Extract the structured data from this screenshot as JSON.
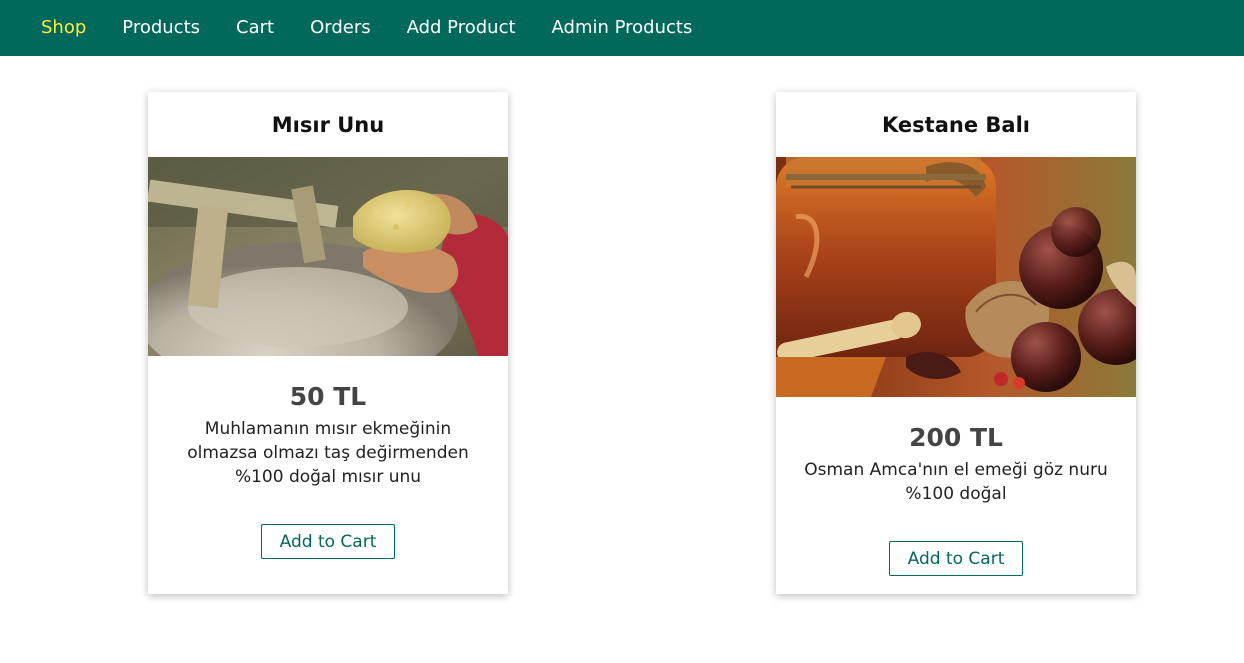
{
  "nav": {
    "items": [
      {
        "label": "Shop",
        "active": true
      },
      {
        "label": "Products"
      },
      {
        "label": "Cart"
      },
      {
        "label": "Orders"
      },
      {
        "label": "Add Product"
      },
      {
        "label": "Admin Products"
      }
    ],
    "active_color": "#ffeb3b",
    "background_color": "#00695c"
  },
  "products": [
    {
      "title": "Mısır Unu",
      "price": "50 TL",
      "description": "Muhlamanın mısır ekmeğinin olmazsa olmazı taş değirmenden %100 doğal mısır unu",
      "button_label": "Add to Cart"
    },
    {
      "title": "Kestane Balı",
      "price": "200 TL",
      "description": "Osman Amca'nın el emeği göz nuru %100 doğal",
      "button_label": "Add to Cart"
    }
  ]
}
